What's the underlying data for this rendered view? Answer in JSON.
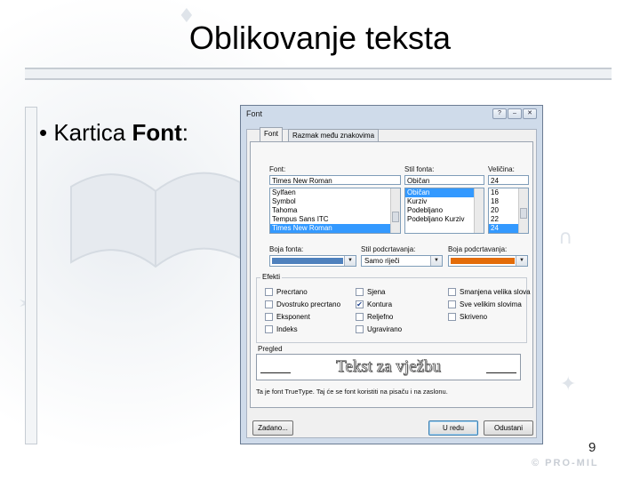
{
  "slide": {
    "title": "Oblikovanje teksta",
    "bullet_prefix": "Kartica",
    "bullet_bold": "Font",
    "bullet_suffix": ":",
    "page_number": "9",
    "watermark": "© PRO-MIL"
  },
  "dialog": {
    "title": "Font",
    "help_icon": "question-icon",
    "close_icon": "close-icon",
    "tabs": [
      {
        "label": "Font",
        "active": true
      },
      {
        "label": "Razmak među znakovima",
        "active": false
      }
    ],
    "font": {
      "label": "Font:",
      "value": "Times New Roman",
      "items": [
        "Sylfaen",
        "Symbol",
        "Tahoma",
        "Tempus Sans ITC",
        "Times New Roman"
      ],
      "selected": 4
    },
    "style": {
      "label": "Stil fonta:",
      "value": "Običan",
      "items": [
        "Običan",
        "Kurziv",
        "Podebljano",
        "Podebljano Kurziv"
      ],
      "selected": 0
    },
    "size": {
      "label": "Veličina:",
      "value": "24",
      "items": [
        "16",
        "18",
        "20",
        "22",
        "24"
      ],
      "selected": 4
    },
    "font_color": {
      "label": "Boja fonta:",
      "color": "#4f81bd"
    },
    "underline_style": {
      "label": "Stil podcrtavanja:",
      "value": "Samo riječi"
    },
    "underline_color": {
      "label": "Boja podcrtavanja:",
      "color": "#e36c09"
    },
    "effects": {
      "label": "Efekti",
      "items": [
        {
          "label": "Precrtano",
          "checked": false
        },
        {
          "label": "Dvostruko precrtano",
          "checked": false
        },
        {
          "label": "Eksponent",
          "checked": false
        },
        {
          "label": "Indeks",
          "checked": false
        },
        {
          "label": "Sjena",
          "checked": false
        },
        {
          "label": "Kontura",
          "checked": true
        },
        {
          "label": "Reljefno",
          "checked": false
        },
        {
          "label": "Ugravirano",
          "checked": false
        },
        {
          "label": "Smanjena velika slova",
          "checked": false
        },
        {
          "label": "Sve velikim slovima",
          "checked": false
        },
        {
          "label": "Skriveno",
          "checked": false
        }
      ]
    },
    "preview": {
      "label": "Pregled",
      "text": "Tekst za vježbu",
      "note": "Ta je font TrueType. Taj će se font koristiti na pisaču i na zaslonu."
    },
    "buttons": {
      "default": "Zadano...",
      "ok": "U redu",
      "cancel": "Odustani"
    }
  }
}
